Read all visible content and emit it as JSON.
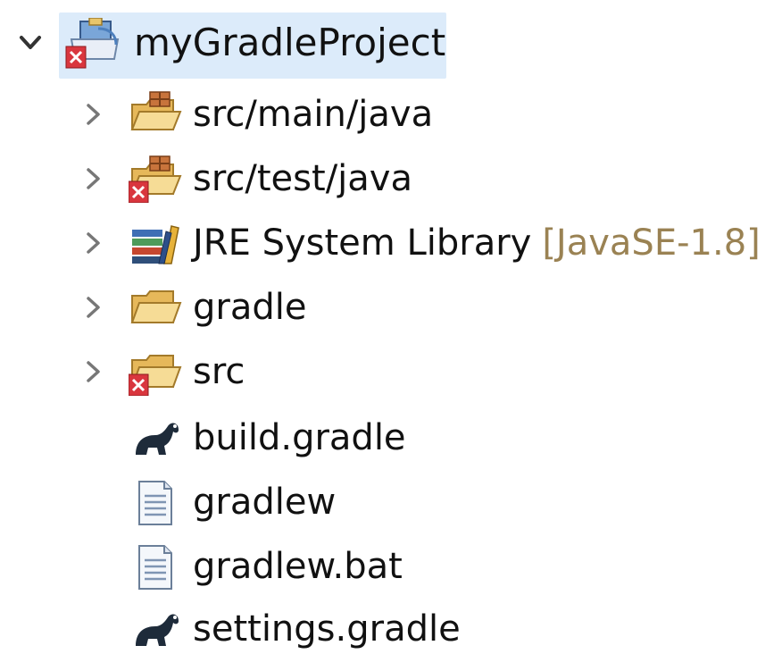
{
  "tree": {
    "root": {
      "label": "myGradleProject",
      "expanded": true,
      "icon": "gradle-project-error-icon"
    },
    "children": [
      {
        "label": "src/main/java",
        "expandable": true,
        "icon": "source-folder-icon"
      },
      {
        "label": "src/test/java",
        "expandable": true,
        "icon": "source-folder-error-icon"
      },
      {
        "label": "JRE System Library",
        "decoration": "[JavaSE-1.8]",
        "expandable": true,
        "icon": "library-icon"
      },
      {
        "label": "gradle",
        "expandable": true,
        "icon": "folder-icon"
      },
      {
        "label": "src",
        "expandable": true,
        "icon": "folder-error-icon"
      },
      {
        "label": "build.gradle",
        "expandable": false,
        "icon": "gradle-file-icon"
      },
      {
        "label": "gradlew",
        "expandable": false,
        "icon": "text-file-icon"
      },
      {
        "label": "gradlew.bat",
        "expandable": false,
        "icon": "text-file-icon"
      },
      {
        "label": "settings.gradle",
        "expandable": false,
        "icon": "gradle-file-icon"
      }
    ]
  },
  "colors": {
    "selection": "#dcebfa",
    "decoration": "#9a8253",
    "folder": "#f3d58a",
    "error": "#d9363e"
  }
}
